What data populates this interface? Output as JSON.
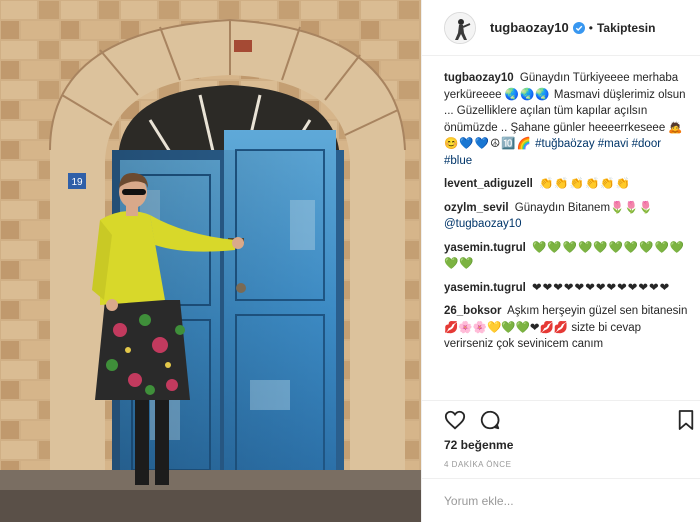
{
  "post": {
    "image_alt": "Woman in yellow jacket leaning on blue wooden door in stone arch",
    "door_number": "19"
  },
  "header": {
    "username": "tugbaozay10",
    "separator": "•",
    "follow_status": "Takiptesin"
  },
  "caption": {
    "username": "tugbaozay10",
    "text_1": "Günaydın Türkiyeeee merhaba yerküreeee",
    "emoji_1": "🌏🌏🌏",
    "text_2": "Masmavi düşlerimiz olsun ... Güzelliklere açılan tüm kapılar açılsın önümüzde .. Şahane günler heeeerrkeseee",
    "emoji_2": "🙇😊💙💙☮🔟🌈",
    "hashtags": "#tuğbaözay #mavi #door #blue"
  },
  "comments": [
    {
      "username": "levent_adiguzell",
      "text": "👏👏👏👏👏👏"
    },
    {
      "username": "ozylm_sevil",
      "text": "Günaydın Bitanem🌷🌷🌷",
      "mention": "@tugbaozay10"
    },
    {
      "username": "yasemin.tugrul",
      "text": "💚💚💚💚💚💚💚💚💚💚💚💚"
    },
    {
      "username": "yasemin.tugrul",
      "text": "❤❤❤❤❤❤❤❤❤❤❤❤❤"
    },
    {
      "username": "26_boksor",
      "text": "Aşkım herşeyin güzel sen bitanesin 💋🌸🌸💛💚💚❤💋💋 sizte bi cevap verirseniz çok sevinicem canım"
    }
  ],
  "actions": {
    "like": "heart-icon",
    "comment": "comment-icon",
    "save": "bookmark-icon"
  },
  "likes": "72 beğenme",
  "timestamp": "4 DAKİKA ÖNCE",
  "add_comment": {
    "placeholder": "Yorum ekle..."
  },
  "colors": {
    "link": "#003569",
    "meta": "#999999",
    "text": "#262626",
    "border": "#efefef"
  }
}
